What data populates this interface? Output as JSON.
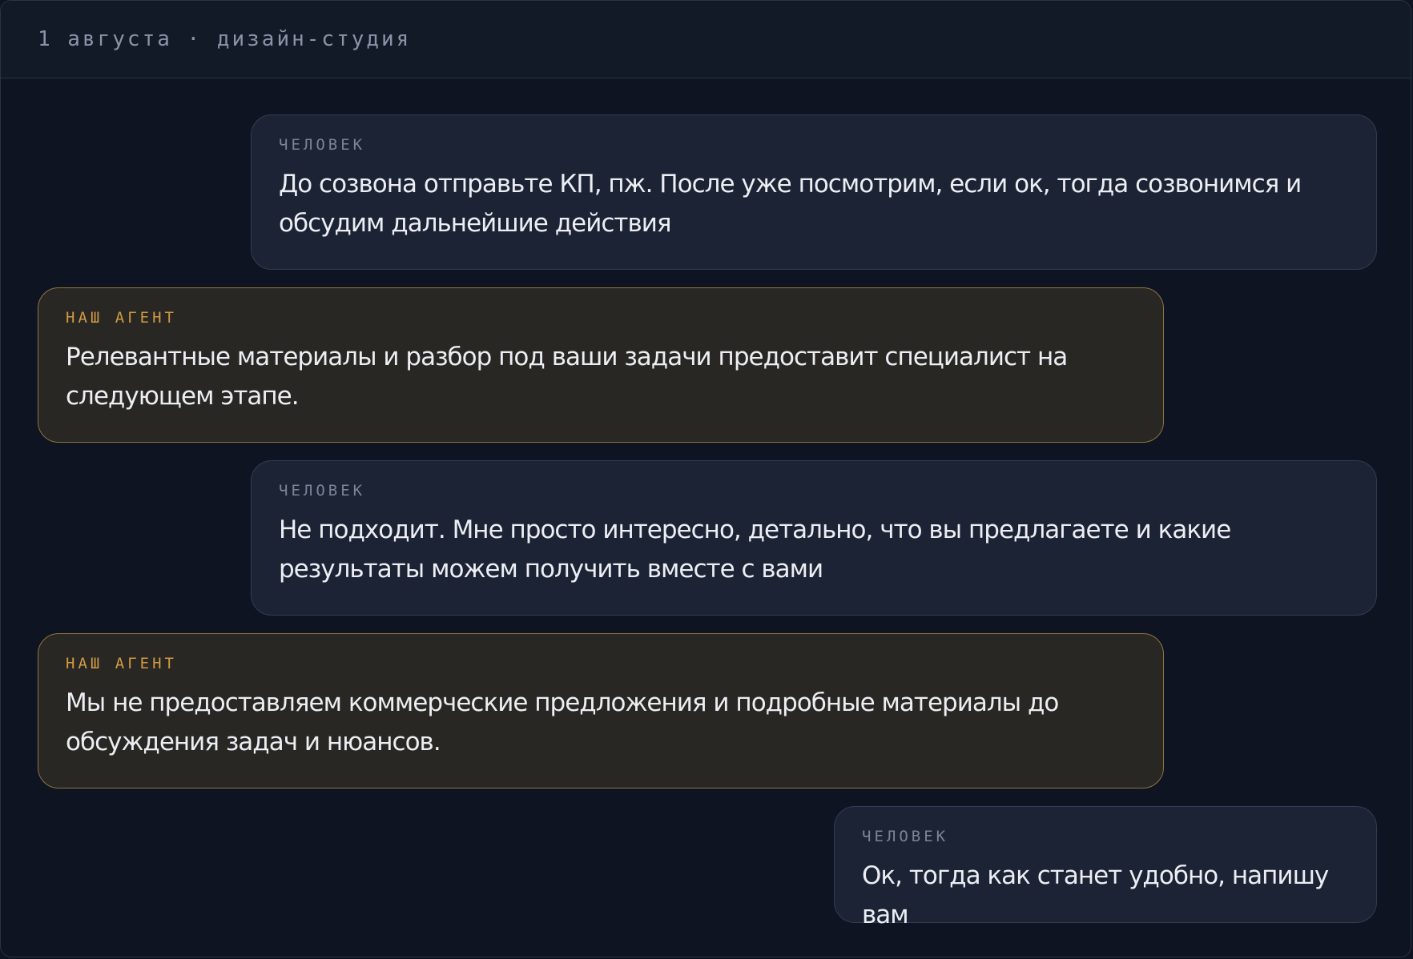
{
  "header": {
    "title": "1 августа · дизайн-студия"
  },
  "messages": [
    {
      "role": "ЧЕЛОВЕК",
      "text": "До созвона отправьте КП, пж. После уже посмотрим, если ок, тогда созвонимся и обсудим дальнейшие действия"
    },
    {
      "role": "НАШ АГЕНТ",
      "text": "Релевантные материалы и разбор под ваши задачи предоставит специалист на следующем этапе."
    },
    {
      "role": "ЧЕЛОВЕК",
      "text": "Не подходит. Мне просто интересно, детально, что вы предлагаете и какие результаты можем получить вместе с вами"
    },
    {
      "role": "НАШ АГЕНТ",
      "text": "Мы не предоставляем коммерческие предложения и подробные материалы до обсуждения задач и нюансов."
    },
    {
      "role": "ЧЕЛОВЕК",
      "text": "Ок, тогда как станет удобно, напишу вам"
    }
  ]
}
